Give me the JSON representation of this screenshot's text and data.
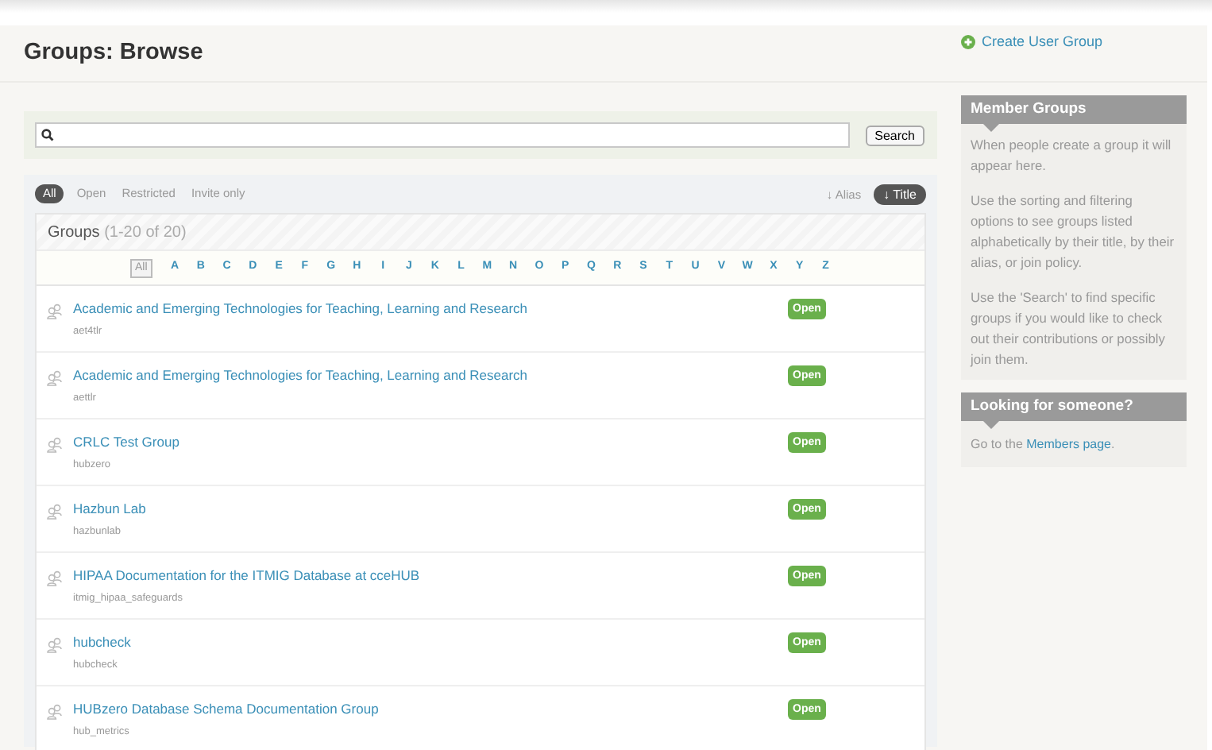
{
  "page_title": "Groups: Browse",
  "create_link": "Create User Group",
  "search": {
    "button": "Search"
  },
  "filters": [
    {
      "label": "All",
      "selected": true
    },
    {
      "label": "Open",
      "selected": false
    },
    {
      "label": "Restricted",
      "selected": false
    },
    {
      "label": "Invite only",
      "selected": false
    }
  ],
  "sort": [
    {
      "label": "↓ Alias",
      "selected": false
    },
    {
      "label": "↓ Title",
      "selected": true
    }
  ],
  "list_title": "Groups",
  "list_count": "(1-20 of 20)",
  "letters": [
    {
      "label": "All",
      "selected": true
    },
    {
      "label": "A",
      "selected": false
    },
    {
      "label": "B",
      "selected": false
    },
    {
      "label": "C",
      "selected": false
    },
    {
      "label": "D",
      "selected": false
    },
    {
      "label": "E",
      "selected": false
    },
    {
      "label": "F",
      "selected": false
    },
    {
      "label": "G",
      "selected": false
    },
    {
      "label": "H",
      "selected": false
    },
    {
      "label": "I",
      "selected": false
    },
    {
      "label": "J",
      "selected": false
    },
    {
      "label": "K",
      "selected": false
    },
    {
      "label": "L",
      "selected": false
    },
    {
      "label": "M",
      "selected": false
    },
    {
      "label": "N",
      "selected": false
    },
    {
      "label": "O",
      "selected": false
    },
    {
      "label": "P",
      "selected": false
    },
    {
      "label": "Q",
      "selected": false
    },
    {
      "label": "R",
      "selected": false
    },
    {
      "label": "S",
      "selected": false
    },
    {
      "label": "T",
      "selected": false
    },
    {
      "label": "U",
      "selected": false
    },
    {
      "label": "V",
      "selected": false
    },
    {
      "label": "W",
      "selected": false
    },
    {
      "label": "X",
      "selected": false
    },
    {
      "label": "Y",
      "selected": false
    },
    {
      "label": "Z",
      "selected": false
    }
  ],
  "groups": [
    {
      "title": "Academic and Emerging Technologies for Teaching, Learning and Research",
      "alias": "aet4tlr",
      "policy": "Open"
    },
    {
      "title": "Academic and Emerging Technologies for Teaching, Learning and Research",
      "alias": "aettlr",
      "policy": "Open"
    },
    {
      "title": "CRLC Test Group",
      "alias": "hubzero",
      "policy": "Open"
    },
    {
      "title": "Hazbun Lab",
      "alias": "hazbunlab",
      "policy": "Open"
    },
    {
      "title": "HIPAA Documentation for the ITMIG Database at cceHUB",
      "alias": "itmig_hipaa_safeguards",
      "policy": "Open"
    },
    {
      "title": "hubcheck",
      "alias": "hubcheck",
      "policy": "Open"
    },
    {
      "title": "HUBzero Database Schema Documentation Group",
      "alias": "hub_metrics",
      "policy": "Open"
    }
  ],
  "sidebar": {
    "member_groups": {
      "title": "Member Groups",
      "paragraphs": [
        "When people create a group it will appear here.",
        "Use the sorting and filtering options to see groups listed alphabetically by their title, by their alias, or join policy.",
        "Use the 'Search' to find specific groups if you would like to check out their contributions or possibly join them."
      ]
    },
    "looking": {
      "title": "Looking for someone?",
      "before": "Go to the ",
      "link": "Members page",
      "after": "."
    }
  }
}
